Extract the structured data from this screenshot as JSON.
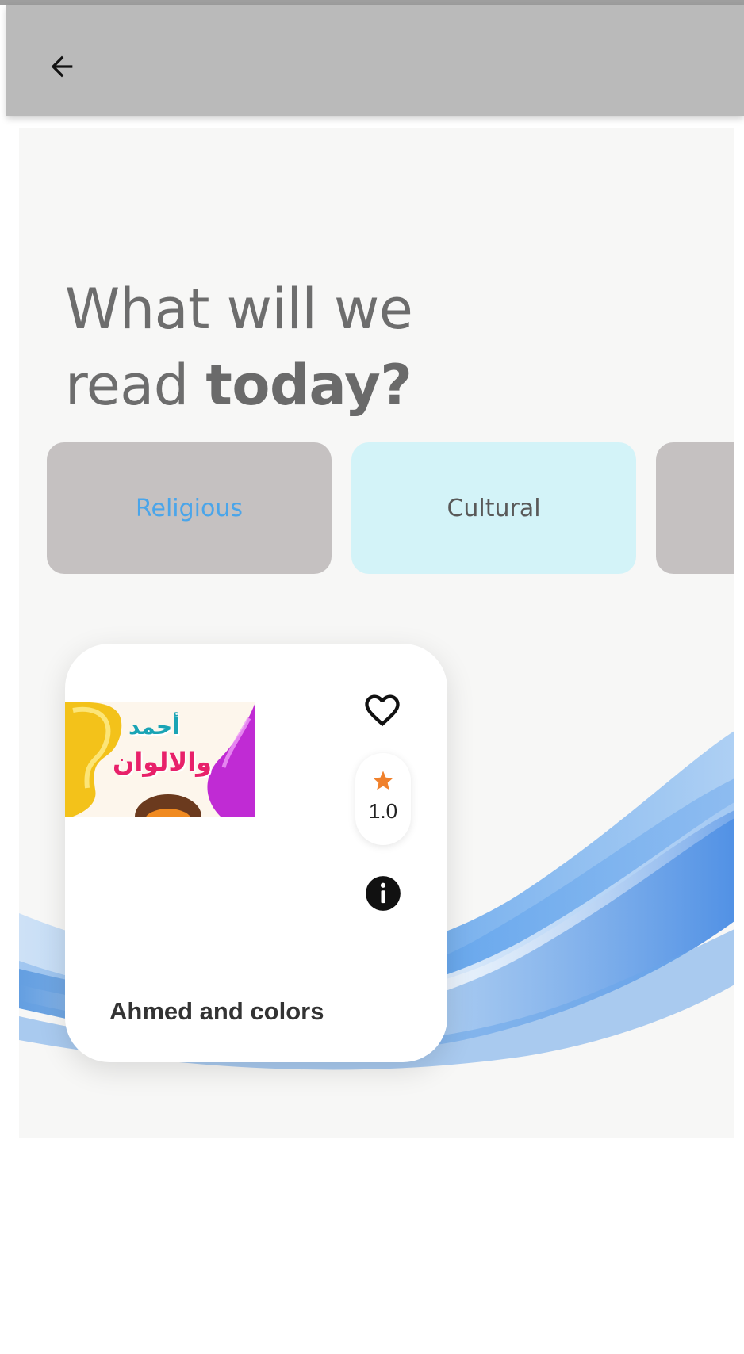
{
  "app_bar": {
    "back_icon": "arrow-left-icon",
    "color": "#bababa"
  },
  "headline": {
    "line1": "What will we",
    "line2_regular": "read ",
    "line2_bold": "today?"
  },
  "categories": [
    {
      "label": "Religious",
      "selected": true,
      "background": "#c5c1c1",
      "text_color": "#4aa5ea"
    },
    {
      "label": "Cultural",
      "selected": false,
      "background": "#d3f3f8",
      "text_color": "#595959"
    },
    {
      "label": "",
      "selected": false,
      "background": "#c5c1c1"
    }
  ],
  "books": [
    {
      "title": "Ahmed and colors",
      "cover_text_line1": "أحمد",
      "cover_text_line2": "والالوان",
      "rating": "1.0",
      "favorite_icon": "heart-outline-icon",
      "rating_icon": "star-icon",
      "info_icon": "info-circle-icon"
    }
  ],
  "colors": {
    "star": "#f0812c",
    "accent_blue": "#4aa5ea",
    "wave_blue": "#3f8fe6"
  }
}
